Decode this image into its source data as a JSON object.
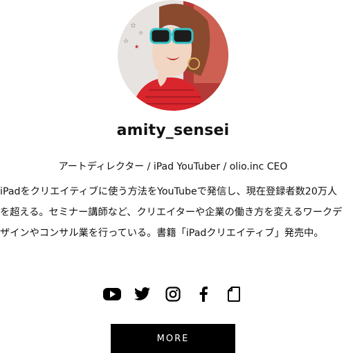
{
  "profile": {
    "avatar_alt": "amity_sensei profile photo",
    "username": "amity_sensei",
    "role": "アートディレクター / iPad YouTuber / olio.inc CEO",
    "bio": "iPadをクリエイティブに使う方法をYouTubeで発信し、現在登録者数20万人を超える。セミナー講師など、クリエイターや企業の働き方を変えるワークデザインやコンサル業を行っている。書籍「iPadクリエイティブ」発売中。"
  },
  "social": [
    {
      "name": "youtube-icon"
    },
    {
      "name": "twitter-icon"
    },
    {
      "name": "instagram-icon"
    },
    {
      "name": "facebook-icon"
    },
    {
      "name": "note-icon"
    }
  ],
  "actions": {
    "more_label": "MORE"
  },
  "colors": {
    "accent": "#000000",
    "background": "#ffffff",
    "text": "#111111"
  }
}
